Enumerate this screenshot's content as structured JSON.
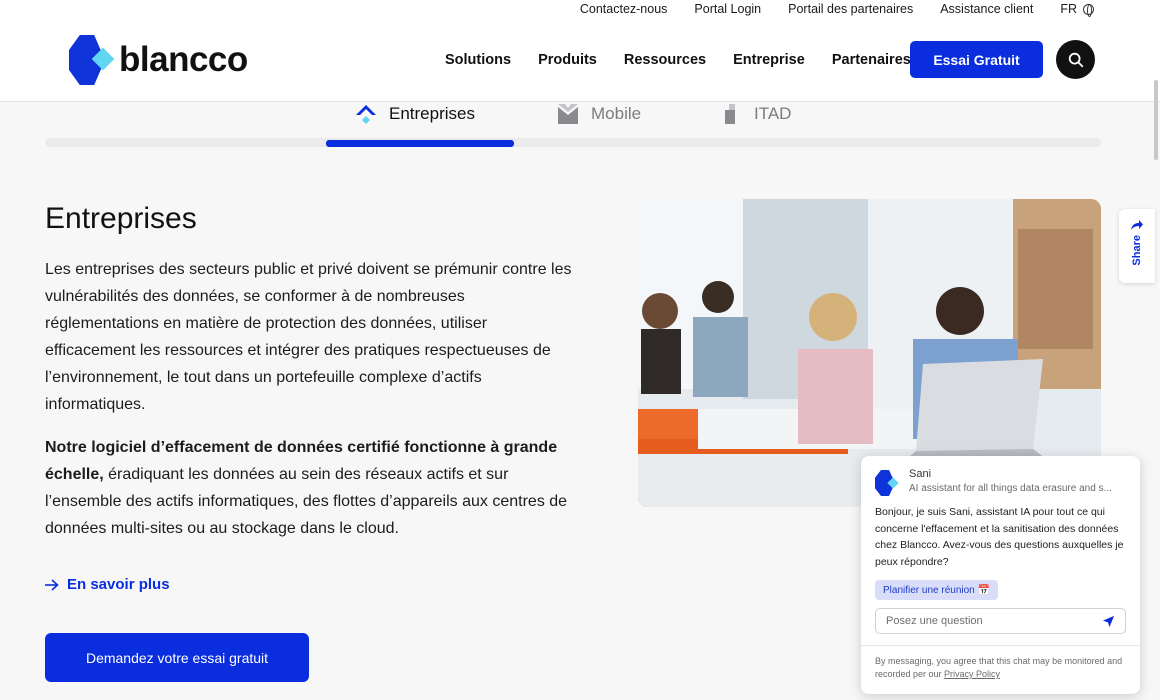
{
  "utility_nav": [
    "Contactez-nous",
    "Portal Login",
    "Portail des partenaires",
    "Assistance client"
  ],
  "language": "FR",
  "logo_text": "blancco",
  "main_nav": [
    "Solutions",
    "Produits",
    "Ressources",
    "Entreprise",
    "Partenaires"
  ],
  "header_cta": "Essai Gratuit",
  "tabs": [
    {
      "label": "Entreprises",
      "active": true
    },
    {
      "label": "Mobile",
      "active": false
    },
    {
      "label": "ITAD",
      "active": false
    }
  ],
  "content": {
    "heading": "Entreprises",
    "paragraph1": "Les entreprises des secteurs public et privé doivent se prémunir contre les vulnérabilités des données, se conformer à de nombreuses réglementations en matière de protection des données, utiliser efficacement les ressources et intégrer des pratiques respectueuses de l’environnement, le tout dans un portefeuille complexe d’actifs informatiques.",
    "paragraph2_bold": "Notre logiciel d’effacement de données certifié fonctionne à grande échelle,",
    "paragraph2_rest": " éradiquant les données au sein des réseaux actifs et sur l’ensemble des actifs informatiques, des flottes d’appareils aux centres de données multi-sites ou au stockage dans le cloud.",
    "learn_more": "En savoir plus",
    "cta": "Demandez votre essai gratuit"
  },
  "share_label": "Share",
  "chat": {
    "name": "Sani",
    "subtitle": "AI assistant for all things data erasure and s...",
    "message": "Bonjour, je suis Sani, assistant IA pour tout ce qui concerne l'effacement et la sanitisation des données chez Blancco. Avez-vous des questions auxquelles je peux répondre?",
    "chip": "Planifier une réunion 📅",
    "input_placeholder": "Posez une question",
    "footer_text": "By messaging, you agree that this chat may be monitored and recorded per our ",
    "footer_link": "Privacy Policy"
  },
  "colors": {
    "brand_blue": "#0a2ddd",
    "brand_cyan": "#62d5f2",
    "background": "#f7f7f8"
  }
}
